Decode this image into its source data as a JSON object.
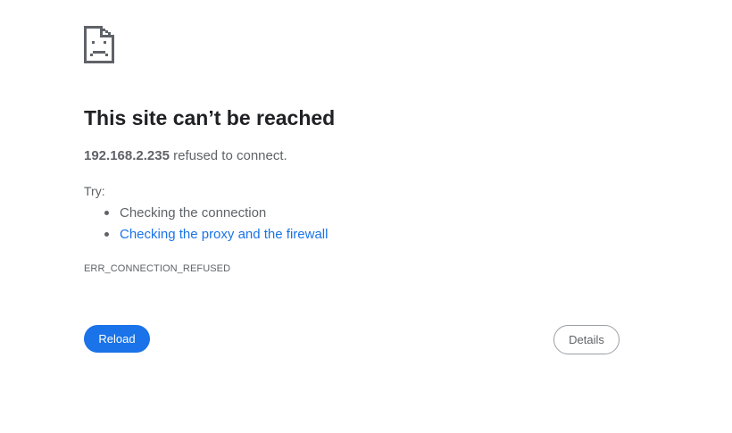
{
  "icon": "sad-page-icon",
  "title": "This site can’t be reached",
  "summary": {
    "host": "192.168.2.235",
    "message": " refused to connect."
  },
  "try_label": "Try:",
  "suggestions": [
    {
      "label": "Checking the connection",
      "link": false
    },
    {
      "label": "Checking the proxy and the firewall",
      "link": true
    }
  ],
  "error_code": "ERR_CONNECTION_REFUSED",
  "buttons": {
    "reload": "Reload",
    "details": "Details"
  },
  "colors": {
    "accent": "#1a73e8",
    "text": "#202124",
    "secondary_text": "#5f6368",
    "button_border": "#9aa0a6"
  }
}
